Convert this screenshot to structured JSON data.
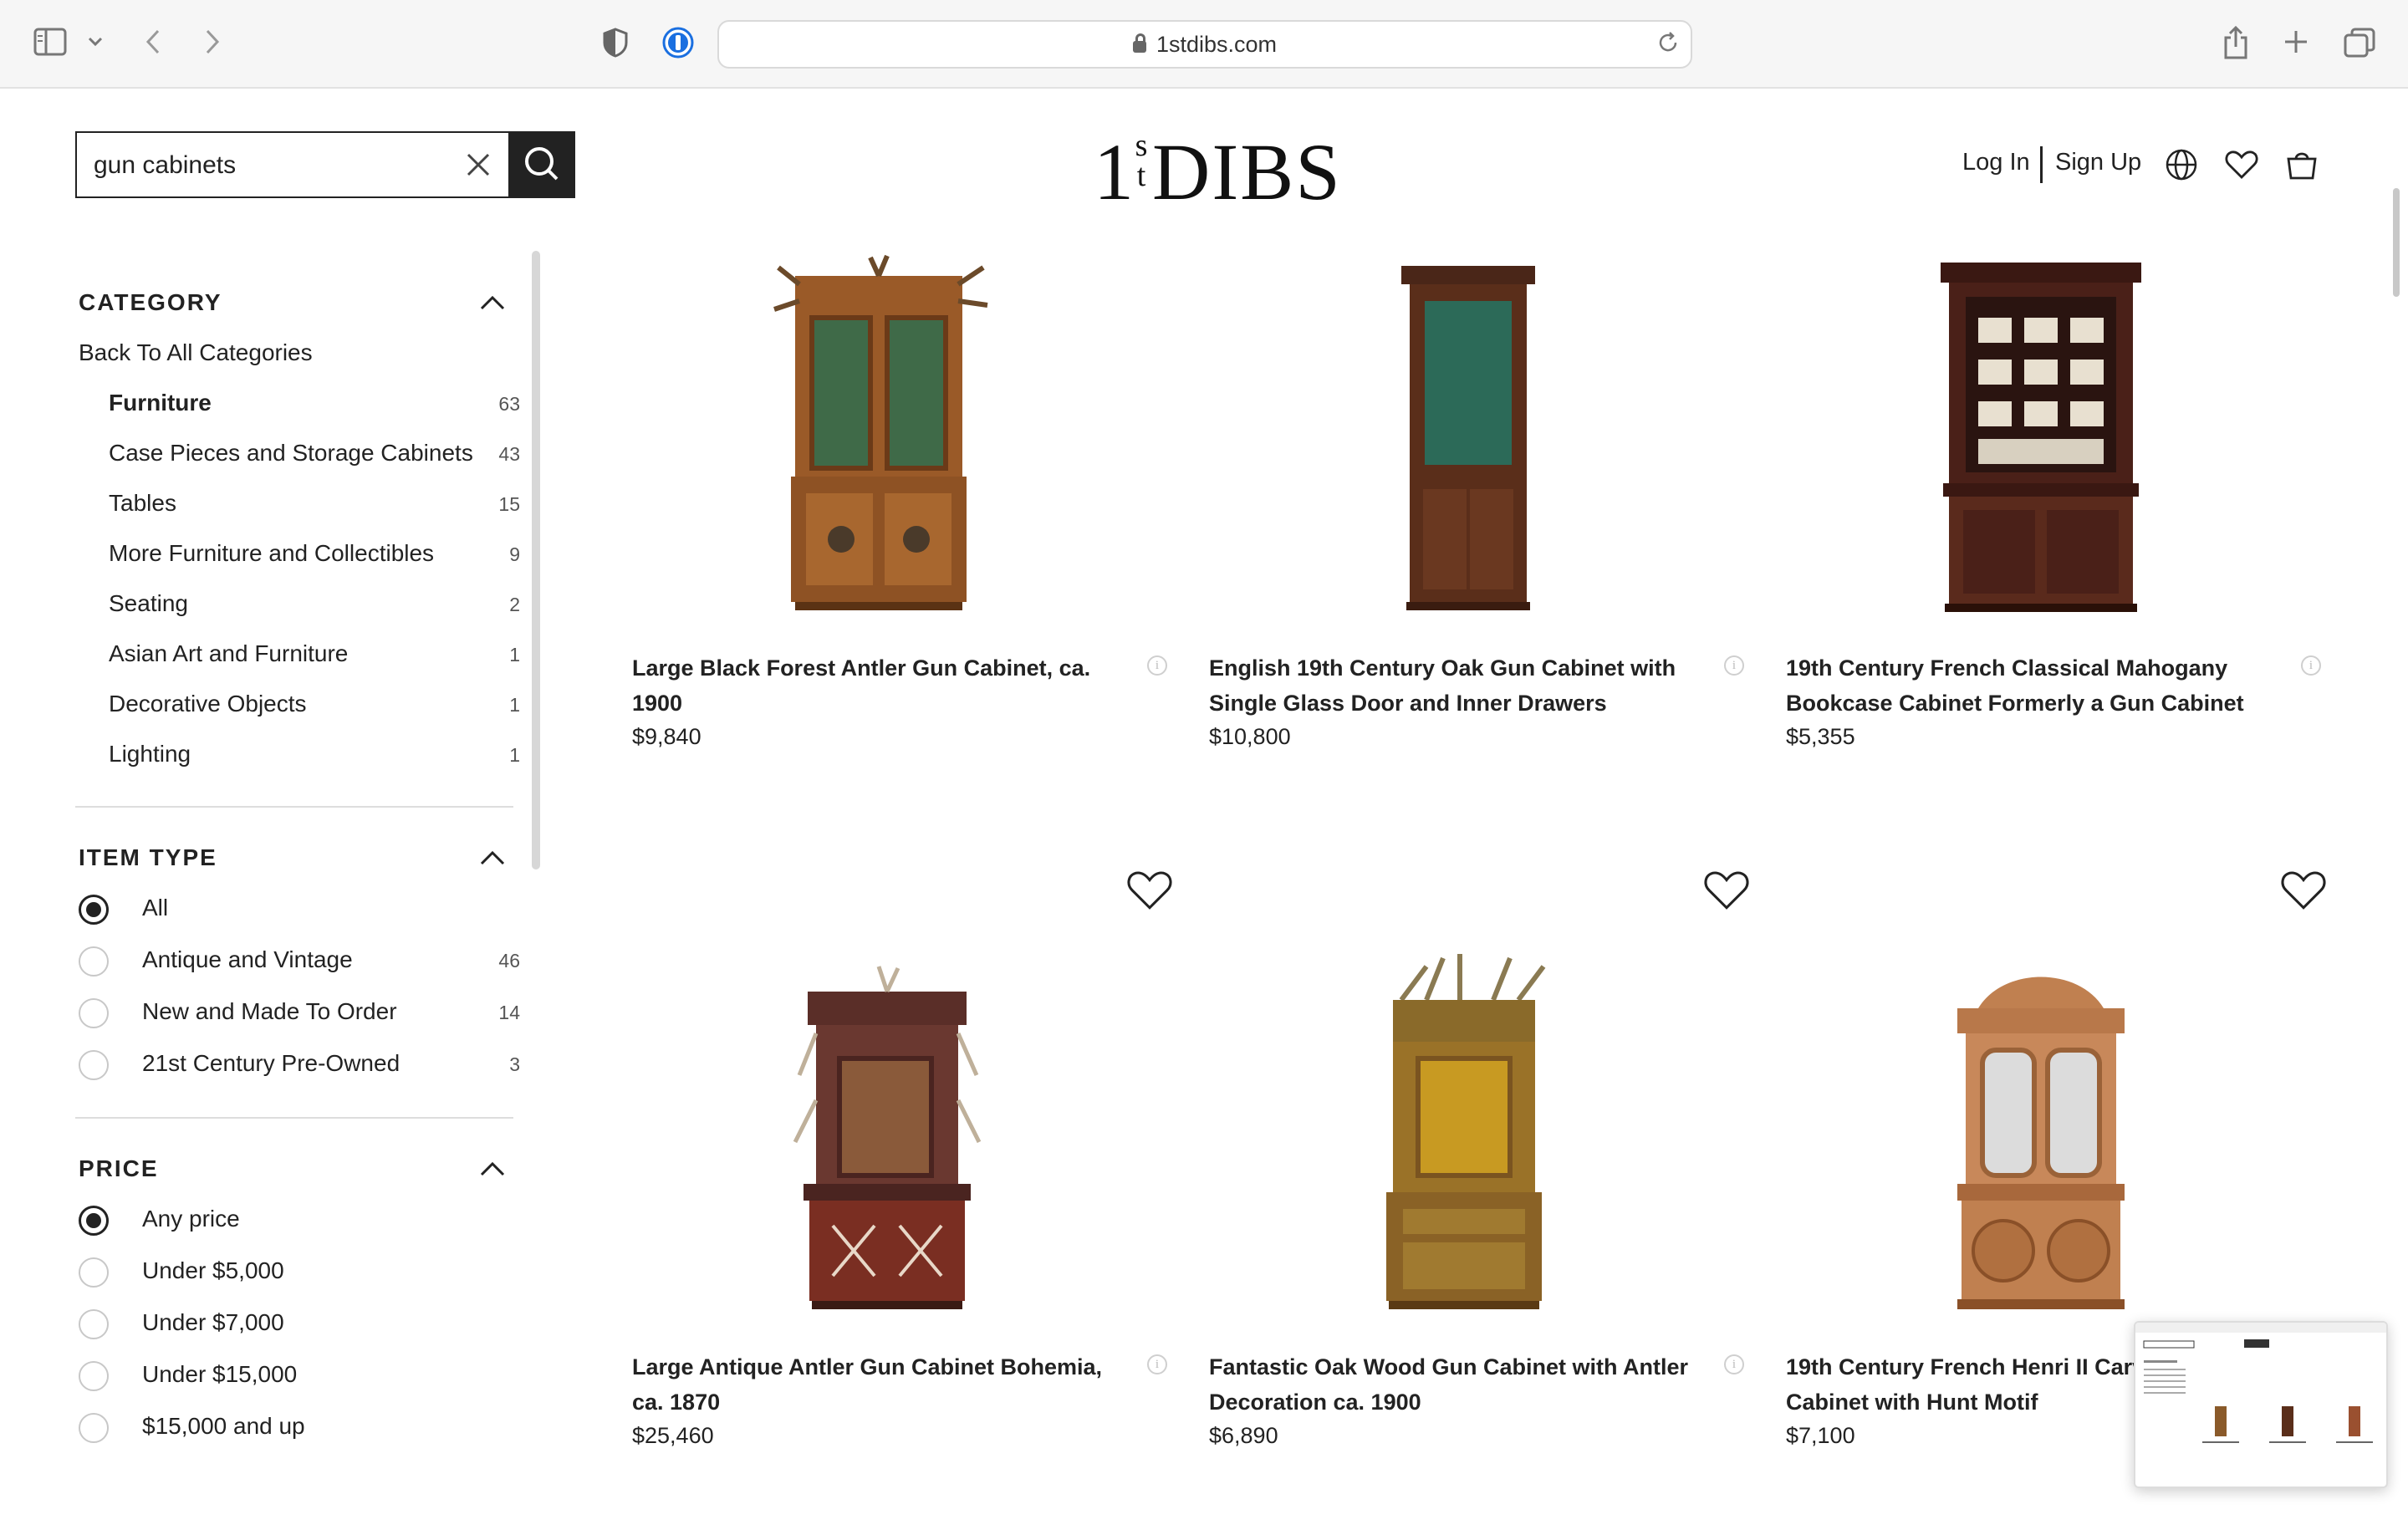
{
  "browser": {
    "url": "1stdibs.com"
  },
  "search": {
    "value": "gun cabinets"
  },
  "logo": {
    "one": "1",
    "st_s": "s",
    "st_t": "t",
    "dibs": "DIBS"
  },
  "auth": {
    "login": "Log In",
    "signup": "Sign Up"
  },
  "category": {
    "title": "CATEGORY",
    "back": "Back To All Categories",
    "items": [
      {
        "label": "Furniture",
        "count": "63"
      },
      {
        "label": "Case Pieces and Storage Cabinets",
        "count": "43"
      },
      {
        "label": "Tables",
        "count": "15"
      },
      {
        "label": "More Furniture and Collectibles",
        "count": "9"
      },
      {
        "label": "Seating",
        "count": "2"
      },
      {
        "label": "Asian Art and Furniture",
        "count": "1"
      },
      {
        "label": "Decorative Objects",
        "count": "1"
      },
      {
        "label": "Lighting",
        "count": "1"
      }
    ]
  },
  "item_type": {
    "title": "ITEM TYPE",
    "options": [
      {
        "label": "All",
        "count": ""
      },
      {
        "label": "Antique and Vintage",
        "count": "46"
      },
      {
        "label": "New and Made To Order",
        "count": "14"
      },
      {
        "label": "21st Century Pre-Owned",
        "count": "3"
      }
    ]
  },
  "price": {
    "title": "PRICE",
    "options": [
      {
        "label": "Any price"
      },
      {
        "label": "Under $5,000"
      },
      {
        "label": "Under $7,000"
      },
      {
        "label": "Under $15,000"
      },
      {
        "label": "$15,000 and up"
      }
    ]
  },
  "products": [
    {
      "title": "Large Black Forest Antler Gun Cabinet, ca. 1900",
      "price": "$9,840"
    },
    {
      "title": "English 19th Century Oak Gun Cabinet with Single Glass Door and Inner Drawers",
      "price": "$10,800"
    },
    {
      "title": "19th Century French Classical Mahogany Bookcase Cabinet Formerly a Gun Cabinet",
      "price": "$5,355"
    },
    {
      "title": "Large Antique Antler Gun Cabinet Bohemia, ca. 1870",
      "price": "$25,460"
    },
    {
      "title": "Fantastic Oak Wood Gun Cabinet with Antler Decoration ca. 1900",
      "price": "$6,890"
    },
    {
      "title": "19th Century French Henri II Carved Oak Gun Cabinet with Hunt Motif",
      "price": "$7,100"
    }
  ],
  "colors": {
    "text": "#222222",
    "accent": "#222222",
    "chrome": "#f6f6f6"
  }
}
